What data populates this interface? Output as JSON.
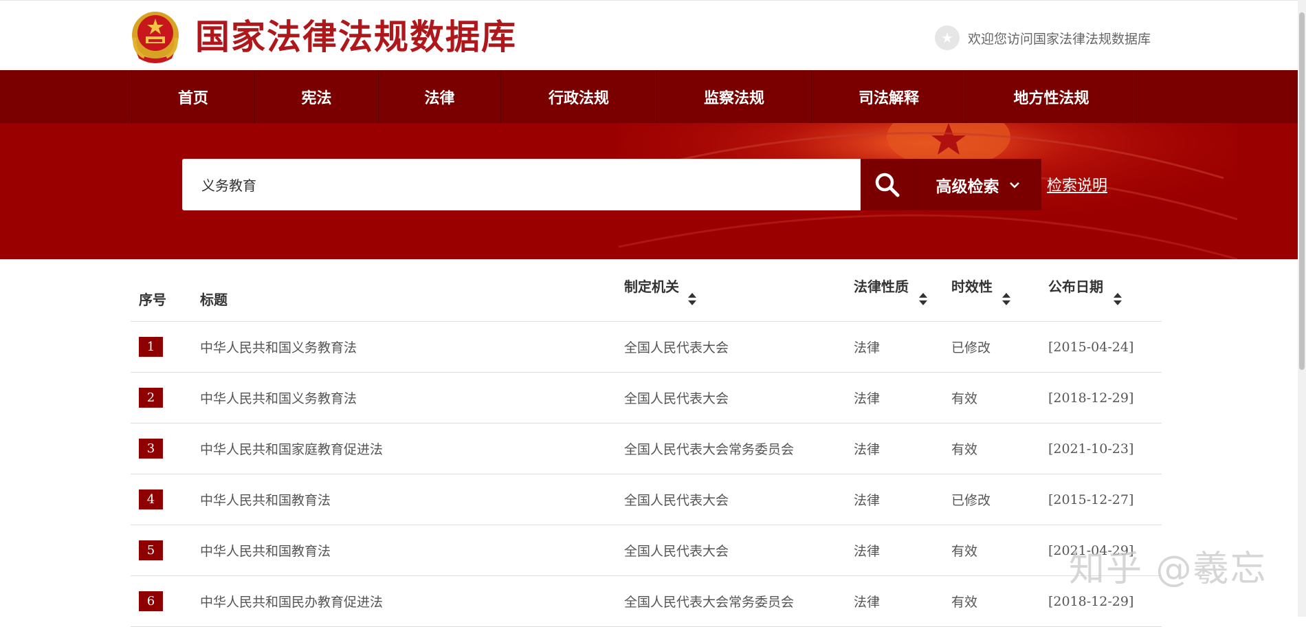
{
  "site": {
    "title": "国家法律法规数据库",
    "welcome": "欢迎您访问国家法律法规数据库"
  },
  "nav": {
    "items": [
      {
        "label": "首页"
      },
      {
        "label": "宪法"
      },
      {
        "label": "法律"
      },
      {
        "label": "行政法规"
      },
      {
        "label": "监察法规"
      },
      {
        "label": "司法解释"
      },
      {
        "label": "地方性法规"
      }
    ]
  },
  "search": {
    "value": "义务教育",
    "advanced_label": "高级检索",
    "help_label": "检索说明"
  },
  "table": {
    "headers": {
      "index": "序号",
      "title": "标题",
      "authority": "制定机关",
      "nature": "法律性质",
      "validity": "时效性",
      "date": "公布日期"
    },
    "rows": [
      {
        "index": "1",
        "title": "中华人民共和国义务教育法",
        "authority": "全国人民代表大会",
        "nature": "法律",
        "validity": "已修改",
        "date": "[2015-04-24]"
      },
      {
        "index": "2",
        "title": "中华人民共和国义务教育法",
        "authority": "全国人民代表大会",
        "nature": "法律",
        "validity": "有效",
        "date": "[2018-12-29]"
      },
      {
        "index": "3",
        "title": "中华人民共和国家庭教育促进法",
        "authority": "全国人民代表大会常务委员会",
        "nature": "法律",
        "validity": "有效",
        "date": "[2021-10-23]"
      },
      {
        "index": "4",
        "title": "中华人民共和国教育法",
        "authority": "全国人民代表大会",
        "nature": "法律",
        "validity": "已修改",
        "date": "[2015-12-27]"
      },
      {
        "index": "5",
        "title": "中华人民共和国教育法",
        "authority": "全国人民代表大会",
        "nature": "法律",
        "validity": "有效",
        "date": "[2021-04-29]"
      },
      {
        "index": "6",
        "title": "中华人民共和国民办教育促进法",
        "authority": "全国人民代表大会常务委员会",
        "nature": "法律",
        "validity": "有效",
        "date": "[2018-12-29]"
      }
    ]
  },
  "watermark": "知乎 @羲忘",
  "colors": {
    "brand_red": "#9b0000",
    "nav_dark_red": "#7a0000",
    "title_red": "#b0171b"
  }
}
